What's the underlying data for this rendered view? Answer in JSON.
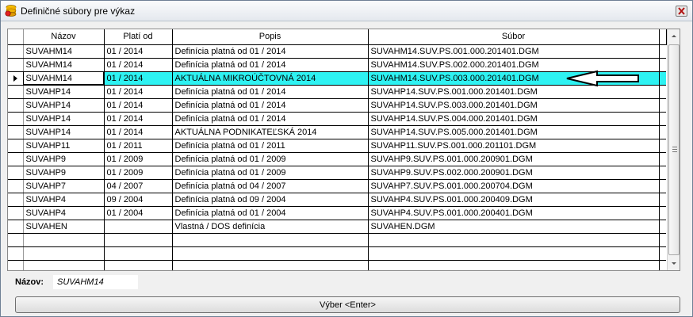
{
  "window": {
    "title": "Definičné súbory pre výkaz"
  },
  "grid": {
    "columns": [
      "Názov",
      "Platí od",
      "Popis",
      "Súbor"
    ],
    "rows": [
      {
        "nazov": "SUVAHM14",
        "plati": "01 / 2014",
        "popis": "Definícia platná od 01 / 2014",
        "subor": "SUVAHM14.SUV.PS.001.000.201401.DGM"
      },
      {
        "nazov": "SUVAHM14",
        "plati": "01 / 2014",
        "popis": "Definícia platná od 01 / 2014",
        "subor": "SUVAHM14.SUV.PS.002.000.201401.DGM"
      },
      {
        "nazov": "SUVAHM14",
        "plati": "01 / 2014",
        "popis": "AKTUÁLNA MIKROÚČTOVNÁ 2014",
        "subor": "SUVAHM14.SUV.PS.003.000.201401.DGM"
      },
      {
        "nazov": "SUVAHP14",
        "plati": "01 / 2014",
        "popis": "Definícia platná od 01 / 2014",
        "subor": "SUVAHP14.SUV.PS.001.000.201401.DGM"
      },
      {
        "nazov": "SUVAHP14",
        "plati": "01 / 2014",
        "popis": "Definícia platná od 01 / 2014",
        "subor": "SUVAHP14.SUV.PS.003.000.201401.DGM"
      },
      {
        "nazov": "SUVAHP14",
        "plati": "01 / 2014",
        "popis": "Definícia platná od 01 / 2014",
        "subor": "SUVAHP14.SUV.PS.004.000.201401.DGM"
      },
      {
        "nazov": "SUVAHP14",
        "plati": "01 / 2014",
        "popis": "AKTUÁLNA PODNIKATEĽSKÁ 2014",
        "subor": "SUVAHP14.SUV.PS.005.000.201401.DGM"
      },
      {
        "nazov": "SUVAHP11",
        "plati": "01 / 2011",
        "popis": "Definícia platná od 01 / 2011",
        "subor": "SUVAHP11.SUV.PS.001.000.201101.DGM"
      },
      {
        "nazov": "SUVAHP9",
        "plati": "01 / 2009",
        "popis": "Definícia platná od 01 / 2009",
        "subor": "SUVAHP9.SUV.PS.001.000.200901.DGM"
      },
      {
        "nazov": "SUVAHP9",
        "plati": "01 / 2009",
        "popis": "Definícia platná od 01 / 2009",
        "subor": "SUVAHP9.SUV.PS.002.000.200901.DGM"
      },
      {
        "nazov": "SUVAHP7",
        "plati": "04 / 2007",
        "popis": "Definícia platná od 04 / 2007",
        "subor": "SUVAHP7.SUV.PS.001.000.200704.DGM"
      },
      {
        "nazov": "SUVAHP4",
        "plati": "09 / 2004",
        "popis": "Definícia platná od 09 / 2004",
        "subor": "SUVAHP4.SUV.PS.001.000.200409.DGM"
      },
      {
        "nazov": "SUVAHP4",
        "plati": "01 / 2004",
        "popis": "Definícia platná od 01 / 2004",
        "subor": "SUVAHP4.SUV.PS.001.000.200401.DGM"
      },
      {
        "nazov": "SUVAHEN",
        "plati": "",
        "popis": "Vlastná / DOS definícia",
        "subor": "SUVAHEN.DGM"
      },
      {
        "nazov": "",
        "plati": "",
        "popis": "",
        "subor": ""
      },
      {
        "nazov": "",
        "plati": "",
        "popis": "",
        "subor": ""
      },
      {
        "nazov": "",
        "plati": "",
        "popis": "",
        "subor": ""
      }
    ],
    "selected_row": 2
  },
  "name_field": {
    "label": "Názov:",
    "value": "SUVAHM14"
  },
  "select_button": {
    "label": "Výber <Enter>"
  },
  "colors": {
    "selection": "#2ef2f2",
    "window_bg": "#f0f0f0"
  },
  "icons": {
    "app": "database-icon",
    "close": "close-icon",
    "pointer": "arrow-left-icon"
  }
}
